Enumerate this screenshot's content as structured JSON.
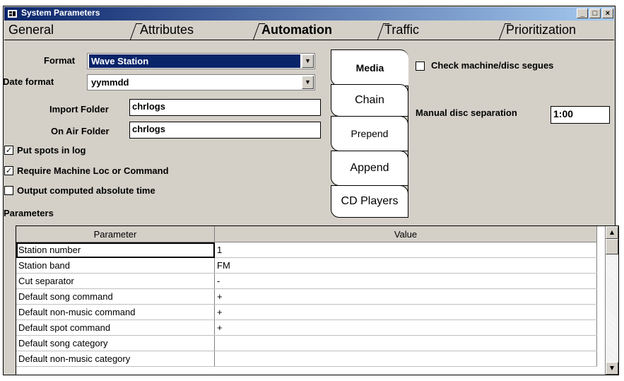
{
  "window": {
    "title": "System Parameters",
    "controls": {
      "minimize": "_",
      "maximize": "□",
      "close": "×"
    }
  },
  "tabs": [
    {
      "label": "General"
    },
    {
      "label": "Attributes"
    },
    {
      "label": "Automation",
      "active": true
    },
    {
      "label": "Traffic"
    },
    {
      "label": "Prioritization"
    }
  ],
  "form": {
    "format_label": "Format",
    "format_value": "Wave Station",
    "date_format_label": "Date format",
    "date_format_value": "yymmdd",
    "import_folder_label": "Import Folder",
    "import_folder_value": "chrlogs",
    "on_air_folder_label": "On Air Folder",
    "on_air_folder_value": "chrlogs",
    "put_spots_label": "Put spots in log",
    "put_spots_checked": true,
    "require_machine_label": "Require Machine Loc or Command",
    "require_machine_checked": true,
    "output_time_label": "Output computed absolute time",
    "output_time_checked": false,
    "parameters_label": "Parameters"
  },
  "side_tabs": [
    {
      "label": "Media",
      "active": true
    },
    {
      "label": "Chain"
    },
    {
      "label": "Prepend"
    },
    {
      "label": "Append"
    },
    {
      "label": "CD Players"
    }
  ],
  "media": {
    "check_segues_label": "Check machine/disc segues",
    "check_segues_checked": false,
    "disc_separation_label": "Manual disc separation",
    "disc_separation_value": "1:00"
  },
  "grid": {
    "headers": [
      "Parameter",
      "Value"
    ],
    "rows": [
      [
        "Station number",
        "1"
      ],
      [
        "Station band",
        "FM"
      ],
      [
        "Cut separator",
        "-"
      ],
      [
        "Default song command",
        "+"
      ],
      [
        "Default non-music command",
        "+"
      ],
      [
        "Default spot command",
        "+"
      ],
      [
        "Default song category",
        ""
      ],
      [
        "Default non-music category",
        ""
      ]
    ]
  },
  "colors": {
    "title_bar": "#0a246a",
    "selection": "#0a246a",
    "face": "#d4d0c8"
  }
}
